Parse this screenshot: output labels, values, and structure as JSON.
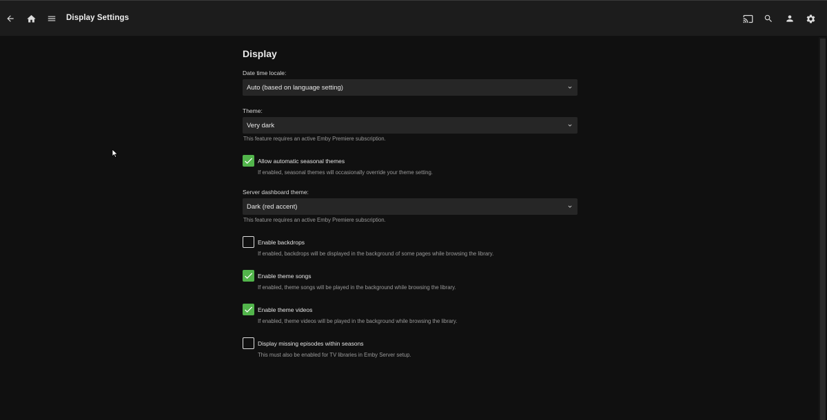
{
  "header": {
    "title": "Display Settings",
    "icons": {
      "back": "back-arrow-icon",
      "home": "home-icon",
      "menu": "hamburger-menu-icon",
      "cast": "cast-icon",
      "search": "search-icon",
      "user": "user-icon",
      "settings": "gear-icon"
    }
  },
  "display": {
    "heading": "Display",
    "date_locale": {
      "label": "Date time locale:",
      "value": "Auto (based on language setting)"
    },
    "theme": {
      "label": "Theme:",
      "value": "Very dark",
      "help": "This feature requires an active Emby Premiere subscription."
    },
    "seasonal_themes": {
      "label": "Allow automatic seasonal themes",
      "help": "If enabled, seasonal themes will occasionally override your theme setting.",
      "checked": true
    },
    "dashboard_theme": {
      "label": "Server dashboard theme:",
      "value": "Dark (red accent)",
      "help": "This feature requires an active Emby Premiere subscription."
    },
    "backdrops": {
      "label": "Enable backdrops",
      "help": "If enabled, backdrops will be displayed in the background of some pages while browsing the library.",
      "checked": false
    },
    "theme_songs": {
      "label": "Enable theme songs",
      "help": "If enabled, theme songs will be played in the background while browsing the library.",
      "checked": true
    },
    "theme_videos": {
      "label": "Enable theme videos",
      "help": "If enabled, theme videos will be played in the background while browsing the library.",
      "checked": true
    },
    "missing_episodes": {
      "label": "Display missing episodes within seasons",
      "help": "This must also be enabled for TV libraries in Emby Server setup.",
      "checked": false
    }
  },
  "colors": {
    "accent_green": "#52b54b",
    "background": "#101010",
    "header": "#1c1c1c",
    "select_bg": "#262626"
  }
}
